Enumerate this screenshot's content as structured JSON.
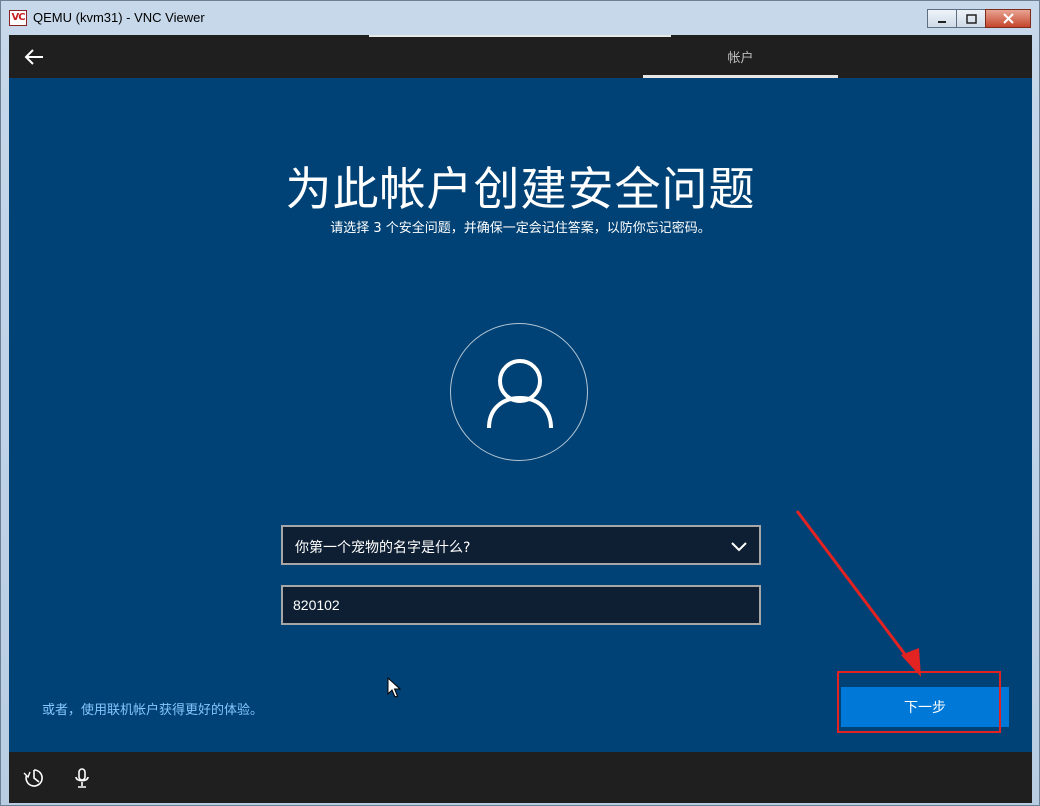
{
  "window": {
    "title": "QEMU (kvm31) - VNC Viewer",
    "icon_text": "VC",
    "buttons": [
      "minimize",
      "maximize",
      "close"
    ]
  },
  "topbar": {
    "tab_label": "帐户"
  },
  "page": {
    "title": "为此帐户创建安全问题",
    "subtitle": "请选择 3 个安全问题，并确保一定会记住答案，以防你忘记密码。"
  },
  "form": {
    "question_value": "你第一个宠物的名字是什么?",
    "answer_value": "820102"
  },
  "footer": {
    "online_account_link": "或者，使用联机帐户获得更好的体验。",
    "next_label": "下一步"
  },
  "colors": {
    "background": "#004275",
    "bar": "#1f1f1f",
    "accent": "#0078d7",
    "link": "#86c6ff",
    "annotation": "#e32222"
  },
  "icons": {
    "back": "back-arrow-icon",
    "avatar": "user-icon",
    "dropdown": "chevron-down-icon",
    "ease_of_access": "ease-of-access-icon",
    "microphone": "microphone-icon"
  }
}
